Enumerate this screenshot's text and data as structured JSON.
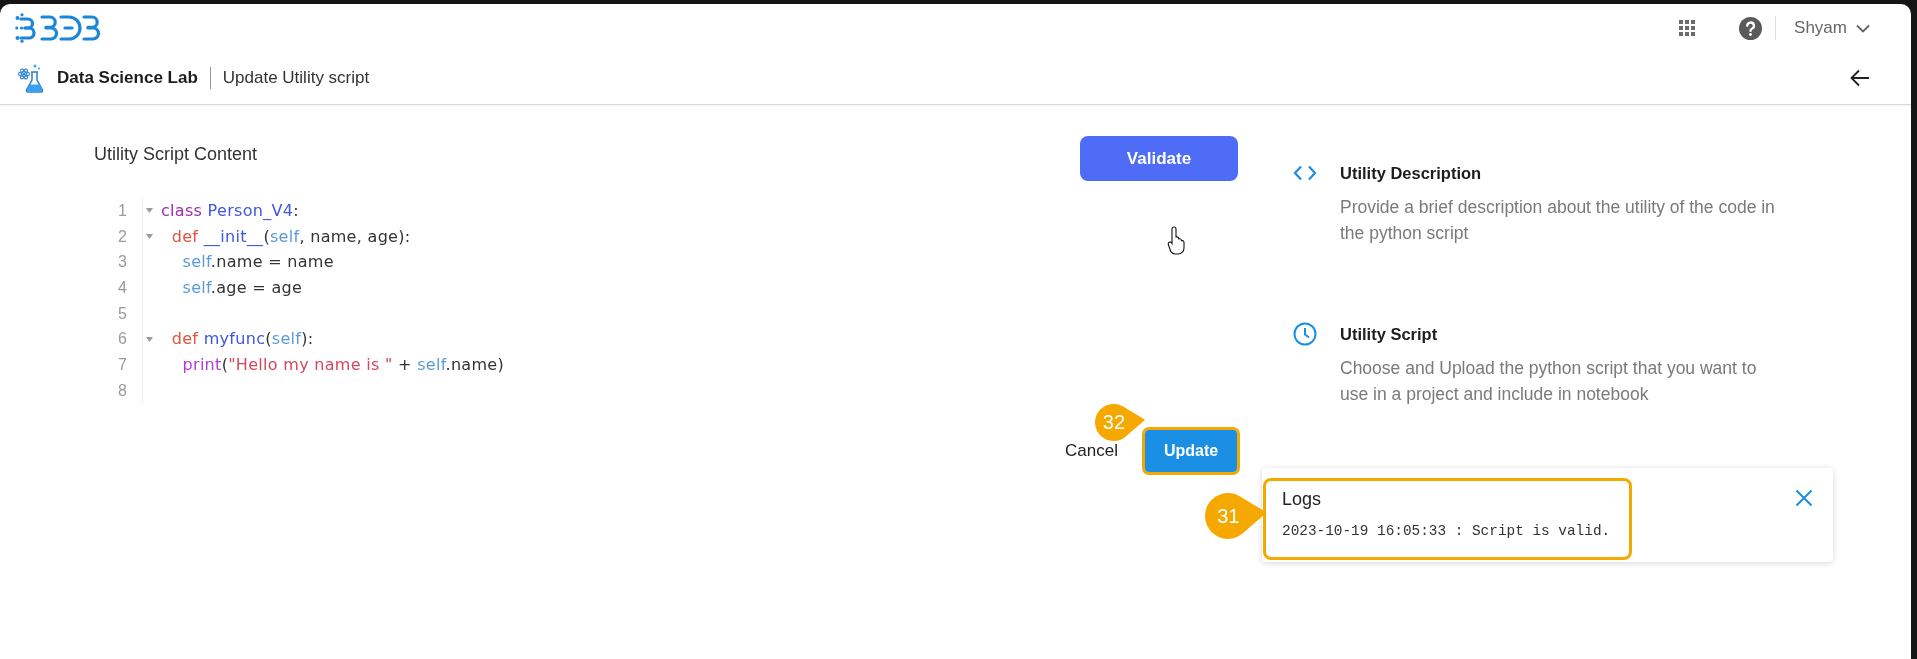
{
  "header": {
    "user_name": "Shyam"
  },
  "breadcrumb": {
    "section": "Data Science Lab",
    "page": "Update Utility script"
  },
  "editor": {
    "title": "Utility Script Content",
    "lines": [
      {
        "number": "1",
        "foldable": true,
        "tokens": [
          {
            "kind": "keyword",
            "text": "class"
          },
          {
            "kind": "name",
            "text": " Person_V4"
          },
          {
            "kind": "plain",
            "text": ":"
          }
        ]
      },
      {
        "number": "2",
        "foldable": true,
        "tokens": [
          {
            "kind": "def",
            "text": "  def"
          },
          {
            "kind": "name",
            "text": " __init__"
          },
          {
            "kind": "plain",
            "text": "("
          },
          {
            "kind": "self",
            "text": "self"
          },
          {
            "kind": "plain",
            "text": ", name, age):"
          }
        ]
      },
      {
        "number": "3",
        "foldable": false,
        "tokens": [
          {
            "kind": "self",
            "text": "    self"
          },
          {
            "kind": "plain",
            "text": ".name = name"
          }
        ]
      },
      {
        "number": "4",
        "foldable": false,
        "tokens": [
          {
            "kind": "self",
            "text": "    self"
          },
          {
            "kind": "plain",
            "text": ".age = age"
          }
        ]
      },
      {
        "number": "5",
        "foldable": false
      },
      {
        "number": "6",
        "foldable": true,
        "tokens": [
          {
            "kind": "def",
            "text": "  def"
          },
          {
            "kind": "name",
            "text": " myfunc"
          },
          {
            "kind": "plain",
            "text": "("
          },
          {
            "kind": "self",
            "text": "self"
          },
          {
            "kind": "plain",
            "text": "):"
          }
        ]
      },
      {
        "number": "7",
        "foldable": false,
        "tokens": [
          {
            "kind": "builtin",
            "text": "    print"
          },
          {
            "kind": "plain",
            "text": "("
          },
          {
            "kind": "string",
            "text": "\"Hello my name is \""
          },
          {
            "kind": "plain",
            "text": " + "
          },
          {
            "kind": "self",
            "text": "self"
          },
          {
            "kind": "plain",
            "text": ".name)"
          }
        ]
      },
      {
        "number": "8",
        "foldable": false
      }
    ]
  },
  "validate": {
    "label": "Validate"
  },
  "actions": [
    {
      "kind": "text",
      "label": "Cancel"
    },
    {
      "kind": "primary",
      "label": "Update",
      "callout": "32"
    }
  ],
  "info": [
    {
      "kind": "code",
      "title": "Utility Description",
      "text": "Provide a brief description about the utility of the code in the python script"
    },
    {
      "kind": "clock",
      "title": "Utility Script",
      "text": "Choose and Upload the python script that you want to use in a project and include in notebook"
    }
  ],
  "logs": {
    "title": "Logs",
    "entries": [
      "2023-10-19 16:05:33 : Script is valid."
    ],
    "callout": "31"
  }
}
